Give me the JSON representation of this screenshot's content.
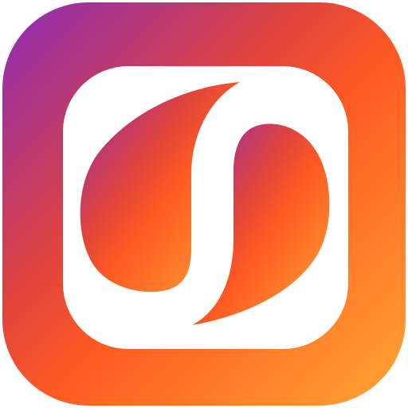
{
  "icon": {
    "name": "app-logo-icon",
    "description_colors": {
      "gradient_top_left": "#8A2BB8",
      "gradient_middle": "#FF5A22",
      "gradient_bottom_right": "#FFA633",
      "logo_foreground": "#FFFFFF"
    }
  }
}
